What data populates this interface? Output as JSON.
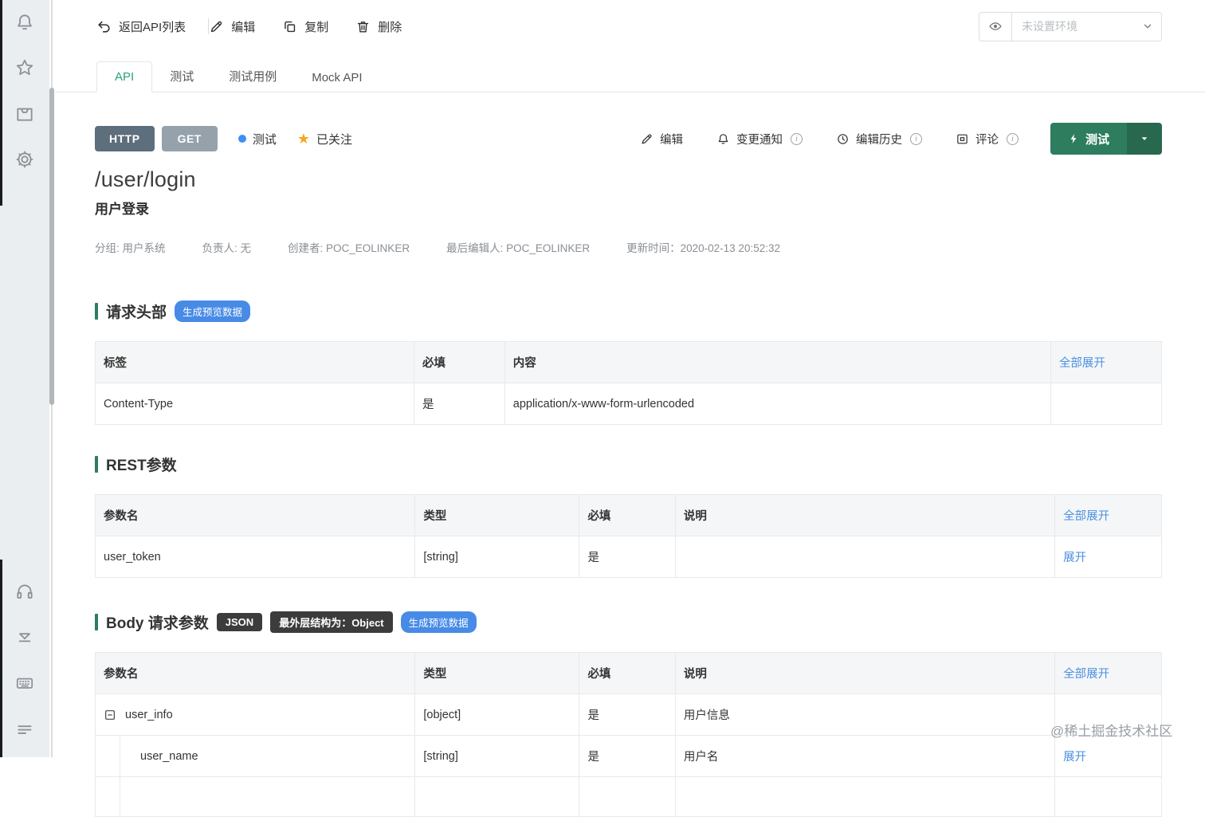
{
  "toolbar": {
    "back": "返回API列表",
    "edit": "编辑",
    "copy": "复制",
    "delete": "删除",
    "env_placeholder": "未设置环境"
  },
  "tabs": [
    {
      "label": "API"
    },
    {
      "label": "测试"
    },
    {
      "label": "测试用例"
    },
    {
      "label": "Mock API"
    }
  ],
  "api": {
    "protocol": "HTTP",
    "method": "GET",
    "status": "测试",
    "follow": "已关注",
    "path": "/user/login",
    "title": "用户登录",
    "meta": {
      "group": "分组: 用户系统",
      "owner": "负责人: 无",
      "creator": "创建者: POC_EOLINKER",
      "editor": "最后编辑人: POC_EOLINKER",
      "updated": "更新时间：2020-02-13 20:52:32"
    }
  },
  "actions": {
    "edit": "编辑",
    "notice": "变更通知",
    "history": "编辑历史",
    "comment": "评论",
    "test": "测试"
  },
  "request_headers": {
    "title": "请求头部",
    "preview_badge": "生成预览数据",
    "col_label": "标签",
    "col_required": "必填",
    "col_content": "内容",
    "expand_all": "全部展开",
    "rows": [
      {
        "label": "Content-Type",
        "required": "是",
        "content": "application/x-www-form-urlencoded"
      }
    ]
  },
  "rest_params": {
    "title": "REST参数",
    "col_name": "参数名",
    "col_type": "类型",
    "col_required": "必填",
    "col_desc": "说明",
    "expand_all": "全部展开",
    "rows": [
      {
        "name": "user_token",
        "type": "[string]",
        "required": "是",
        "desc": "",
        "action": "展开"
      }
    ]
  },
  "body_params": {
    "title": "Body 请求参数",
    "format_badge": "JSON",
    "structure_badge": "最外层结构为：Object",
    "preview_badge": "生成预览数据",
    "col_name": "参数名",
    "col_type": "类型",
    "col_required": "必填",
    "col_desc": "说明",
    "expand_all": "全部展开",
    "rows": [
      {
        "name": "user_info",
        "type": "[object]",
        "required": "是",
        "desc": "用户信息",
        "action": ""
      },
      {
        "name": "user_name",
        "type": "[string]",
        "required": "是",
        "desc": "用户名",
        "action": "展开"
      }
    ]
  },
  "watermark": "@稀土掘金技术社区",
  "colors": {
    "accent_green": "#2e7d5e",
    "tab_active_green": "#27a17b",
    "link_blue": "#4a90e2",
    "badge_blue": "#478be6",
    "dark_badge": "#3c3c3c",
    "http_badge": "#5d6e7c",
    "method_badge": "#95a2ac",
    "star_orange": "#f5a623",
    "status_dot": "#3e8ef7"
  }
}
